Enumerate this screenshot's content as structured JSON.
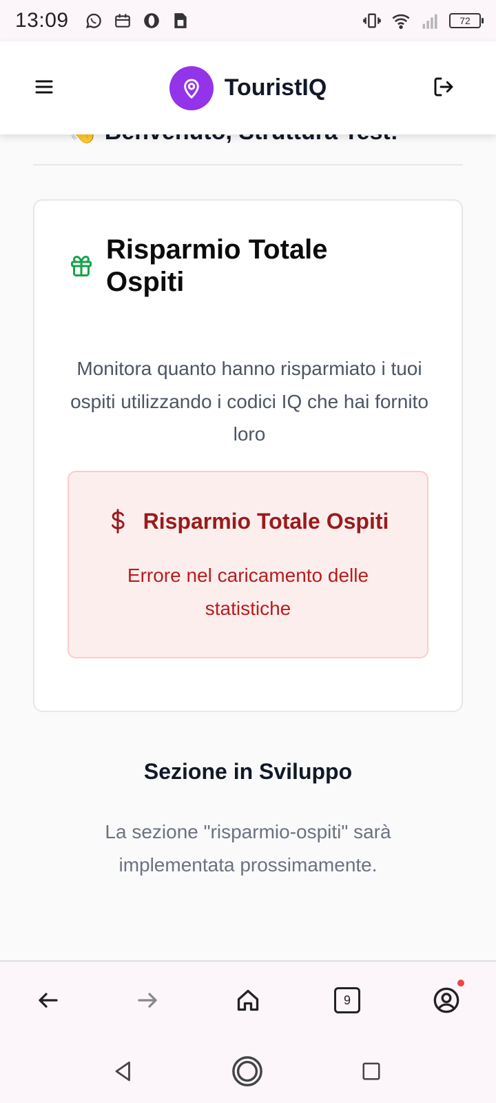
{
  "status_bar": {
    "time": "13:09",
    "left_icons": [
      "whatsapp-icon",
      "calendar-icon",
      "opera-icon",
      "sim-icon"
    ],
    "right_icons": [
      "vibrate-icon",
      "wifi-icon",
      "signal-icon"
    ],
    "battery": "72"
  },
  "header": {
    "brand_name": "TouristIQ",
    "brand_color": "#9333ea",
    "menu_icon": "menu-icon",
    "logout_icon": "logout-icon"
  },
  "page": {
    "greeting_peek": "👋 Benvenuto, Struttura Test!"
  },
  "card": {
    "icon": "gift-icon",
    "icon_color": "#16a34a",
    "title": "Risparmio Totale Ospiti",
    "description": "Monitora quanto hanno risparmiato i tuoi ospiti utilizzando i codici IQ che hai fornito loro",
    "error": {
      "icon": "dollar-icon",
      "title": "Risparmio Totale Ospiti",
      "message": "Errore nel caricamento delle statistiche"
    }
  },
  "dev_section": {
    "title": "Sezione in Sviluppo",
    "description": "La sezione \"risparmio-ospiti\" sarà implementata prossimamente."
  },
  "browser_bar": {
    "tab_count": "9",
    "buttons": [
      "back-icon",
      "forward-icon",
      "home-icon",
      "tabs-icon",
      "account-icon"
    ]
  },
  "system_nav": {
    "buttons": [
      "nav-back-icon",
      "nav-home-icon",
      "nav-recents-icon"
    ]
  }
}
